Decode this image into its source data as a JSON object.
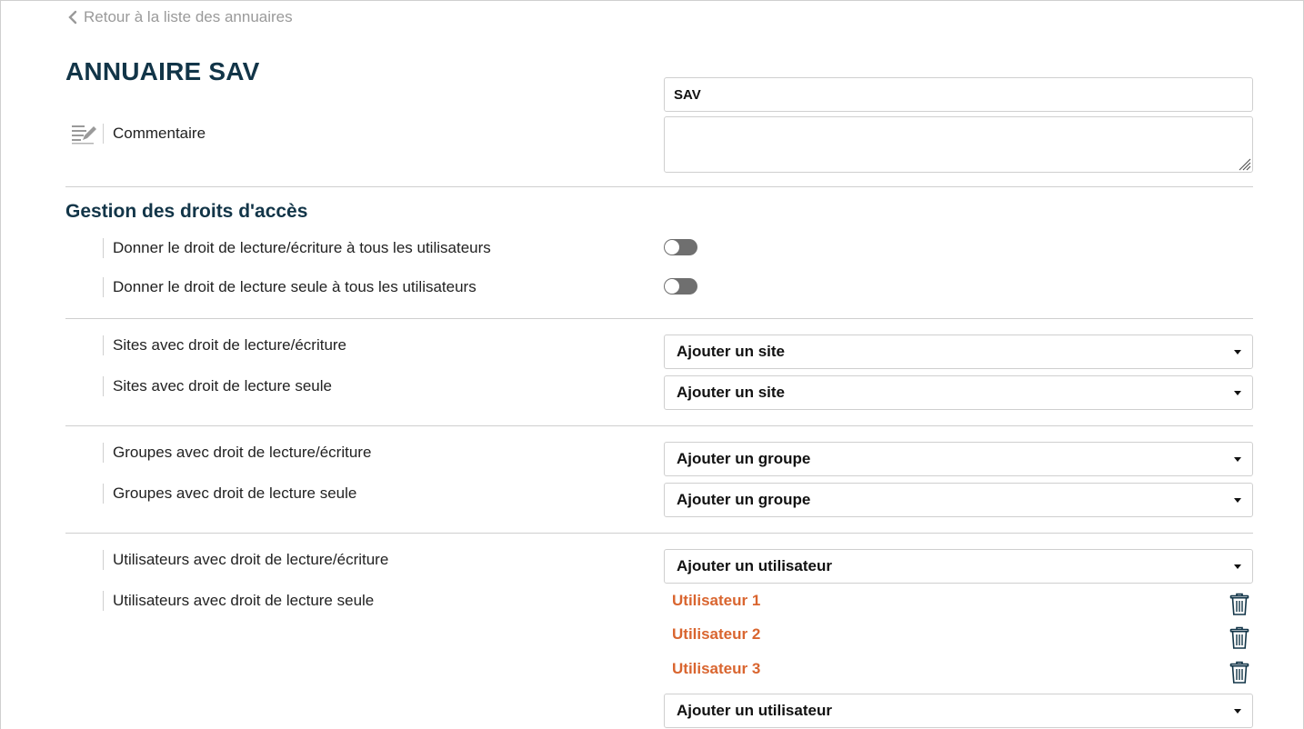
{
  "back_link": {
    "label": "Retour à la liste des annuaires",
    "icon": "chevron-left-icon"
  },
  "title": "ANNUAIRE SAV",
  "name_field": {
    "value": "SAV"
  },
  "comment": {
    "label": "Commentaire",
    "icon": "edit-note-icon",
    "value": ""
  },
  "access_section": {
    "title": "Gestion des droits d'accès",
    "toggles": [
      {
        "label": "Donner le droit de lecture/écriture à tous les utilisateurs",
        "on": false
      },
      {
        "label": "Donner le droit de lecture seule à tous les utilisateurs",
        "on": false
      }
    ]
  },
  "sites": {
    "rw_label": "Sites avec droit de lecture/écriture",
    "rw_select": "Ajouter un site",
    "ro_label": "Sites avec droit de lecture seule",
    "ro_select": "Ajouter un site"
  },
  "groups": {
    "rw_label": "Groupes avec droit de lecture/écriture",
    "rw_select": "Ajouter un groupe",
    "ro_label": "Groupes avec droit de lecture seule",
    "ro_select": "Ajouter un groupe"
  },
  "users": {
    "rw_label": "Utilisateurs avec droit de lecture/écriture",
    "rw_select": "Ajouter un utilisateur",
    "ro_label": "Utilisateurs avec droit de lecture seule",
    "ro_items": [
      "Utilisateur 1",
      "Utilisateur 2",
      "Utilisateur 3"
    ],
    "ro_select": "Ajouter un utilisateur"
  },
  "colors": {
    "title": "#123548",
    "accent_user": "#d9652f",
    "toggle_off": "#6f6f6f",
    "border": "#cfcfcf"
  }
}
